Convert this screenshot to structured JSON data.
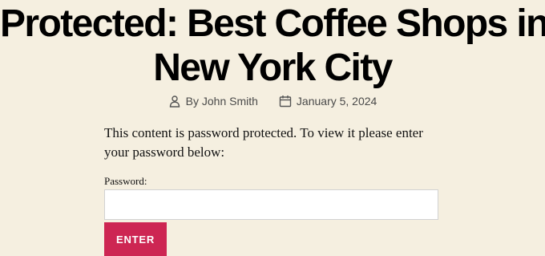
{
  "post": {
    "title_line1": "Protected: Best Coffee Shops in",
    "title_line2": "New York City",
    "author_label": "By John Smith",
    "date_label": "January 5, 2024",
    "author_icon": "person-icon",
    "date_icon": "calendar-icon"
  },
  "protected": {
    "notice": "This content is password protected. To view it please enter your password below:",
    "password_label": "Password:",
    "password_value": "",
    "enter_label": "ENTER"
  },
  "colors": {
    "background": "#f5efe0",
    "accent": "#cd2653",
    "meta_text": "#4a4a4a"
  }
}
